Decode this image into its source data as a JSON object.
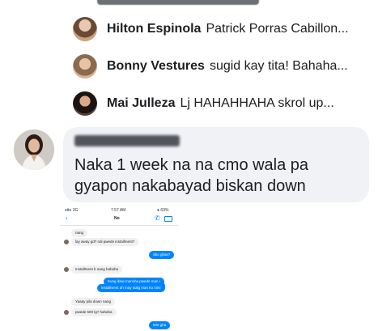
{
  "replies": [
    {
      "name": "Hilton Espinola",
      "text": "Patrick Porras Cabillon..."
    },
    {
      "name": "Bonny Vestures",
      "text": "sugid kay tita! Bahaha..."
    },
    {
      "name": "Mai Julleza",
      "text": "Lj HAHAHHAHA skrol up..."
    }
  ],
  "comment": {
    "text": "Naka 1 week na na cmo wala pa gyapon nakabayad biskan down"
  },
  "embedded_chat": {
    "status": {
      "left": "ette 3G",
      "time": "7:57 AM",
      "right": "● 69%"
    },
    "header": {
      "back": "‹",
      "title": "No",
      "call": "✆"
    },
    "messages": [
      {
        "side": "in",
        "text": "nang"
      },
      {
        "side": "in",
        "text": "lay away gd? ndi pwede installment?"
      },
      {
        "side": "out",
        "text": "Sko ghas?"
      },
      {
        "side": "in",
        "text": "Installment b nang hahaha"
      },
      {
        "side": "out",
        "text": "Kung ikaw mancha pwede man i"
      },
      {
        "side": "out",
        "text": "installment ah may sulig man ko nimi"
      },
      {
        "side": "in",
        "text": "Yaaay pila down nang"
      },
      {
        "side": "in",
        "text": "pwede 500 lg? hahaha"
      },
      {
        "side": "out",
        "text": "500 gha"
      }
    ]
  },
  "colors": {
    "bubble_bg": "#f0f2f5",
    "messenger_blue": "#0084ff"
  }
}
